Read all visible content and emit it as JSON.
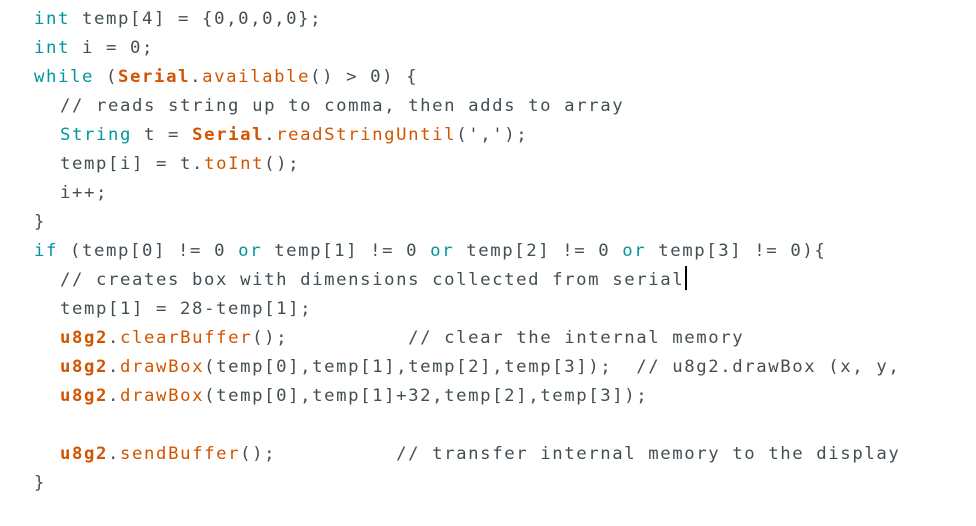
{
  "editor": {
    "lines": [
      {
        "parts": [
          {
            "t": "int",
            "c": "kw"
          },
          {
            "t": " temp[4] = {0,0,0,0};",
            "c": "op"
          }
        ]
      },
      {
        "parts": [
          {
            "t": "int",
            "c": "kw"
          },
          {
            "t": " i = 0;",
            "c": "op"
          }
        ]
      },
      {
        "parts": [
          {
            "t": "while",
            "c": "kw"
          },
          {
            "t": " (",
            "c": "op"
          },
          {
            "t": "Serial",
            "c": "cls"
          },
          {
            "t": ".",
            "c": "op"
          },
          {
            "t": "available",
            "c": "fn"
          },
          {
            "t": "() > 0) {",
            "c": "op"
          }
        ]
      },
      {
        "indent": 1,
        "parts": [
          {
            "t": "// reads string up to comma, then adds to array",
            "c": "cm"
          }
        ]
      },
      {
        "indent": 1,
        "parts": [
          {
            "t": "String",
            "c": "kw"
          },
          {
            "t": " t = ",
            "c": "op"
          },
          {
            "t": "Serial",
            "c": "cls"
          },
          {
            "t": ".",
            "c": "op"
          },
          {
            "t": "readStringUntil",
            "c": "fn"
          },
          {
            "t": "(',');",
            "c": "op"
          }
        ]
      },
      {
        "indent": 1,
        "parts": [
          {
            "t": "temp[i] = t.",
            "c": "op"
          },
          {
            "t": "toInt",
            "c": "fn"
          },
          {
            "t": "();",
            "c": "op"
          }
        ]
      },
      {
        "indent": 1,
        "parts": [
          {
            "t": "i++;",
            "c": "op"
          }
        ]
      },
      {
        "parts": [
          {
            "t": "}",
            "c": "op"
          }
        ]
      },
      {
        "parts": [
          {
            "t": "if",
            "c": "kw"
          },
          {
            "t": " (temp[0] != 0 ",
            "c": "op"
          },
          {
            "t": "or",
            "c": "kw"
          },
          {
            "t": " temp[1] != 0 ",
            "c": "op"
          },
          {
            "t": "or",
            "c": "kw"
          },
          {
            "t": " temp[2] != 0 ",
            "c": "op"
          },
          {
            "t": "or",
            "c": "kw"
          },
          {
            "t": " temp[3] != 0){",
            "c": "op"
          }
        ]
      },
      {
        "indent": 1,
        "caret": true,
        "parts": [
          {
            "t": "// creates box with dimensions collected from serial",
            "c": "cm"
          }
        ]
      },
      {
        "indent": 1,
        "parts": [
          {
            "t": "temp[1] = 28-temp[1];",
            "c": "op"
          }
        ]
      },
      {
        "indent": 1,
        "parts": [
          {
            "t": "u8g2",
            "c": "cls"
          },
          {
            "t": ".",
            "c": "op"
          },
          {
            "t": "clearBuffer",
            "c": "fn"
          },
          {
            "t": "();          ",
            "c": "op"
          },
          {
            "t": "// clear the internal memory",
            "c": "cm"
          }
        ]
      },
      {
        "indent": 1,
        "parts": [
          {
            "t": "u8g2",
            "c": "cls"
          },
          {
            "t": ".",
            "c": "op"
          },
          {
            "t": "drawBox",
            "c": "fn"
          },
          {
            "t": "(temp[0],temp[1],temp[2],temp[3]);  ",
            "c": "op"
          },
          {
            "t": "// u8g2.drawBox (x, y,",
            "c": "cm"
          }
        ]
      },
      {
        "indent": 1,
        "parts": [
          {
            "t": "u8g2",
            "c": "cls"
          },
          {
            "t": ".",
            "c": "op"
          },
          {
            "t": "drawBox",
            "c": "fn"
          },
          {
            "t": "(temp[0],temp[1]+32,temp[2],temp[3]);",
            "c": "op"
          }
        ]
      },
      {
        "parts": []
      },
      {
        "indent": 1,
        "parts": [
          {
            "t": "u8g2",
            "c": "cls"
          },
          {
            "t": ".",
            "c": "op"
          },
          {
            "t": "sendBuffer",
            "c": "fn"
          },
          {
            "t": "();          ",
            "c": "op"
          },
          {
            "t": "// transfer internal memory to the display",
            "c": "cm"
          }
        ]
      },
      {
        "parts": [
          {
            "t": "}",
            "c": "op"
          }
        ]
      }
    ]
  }
}
